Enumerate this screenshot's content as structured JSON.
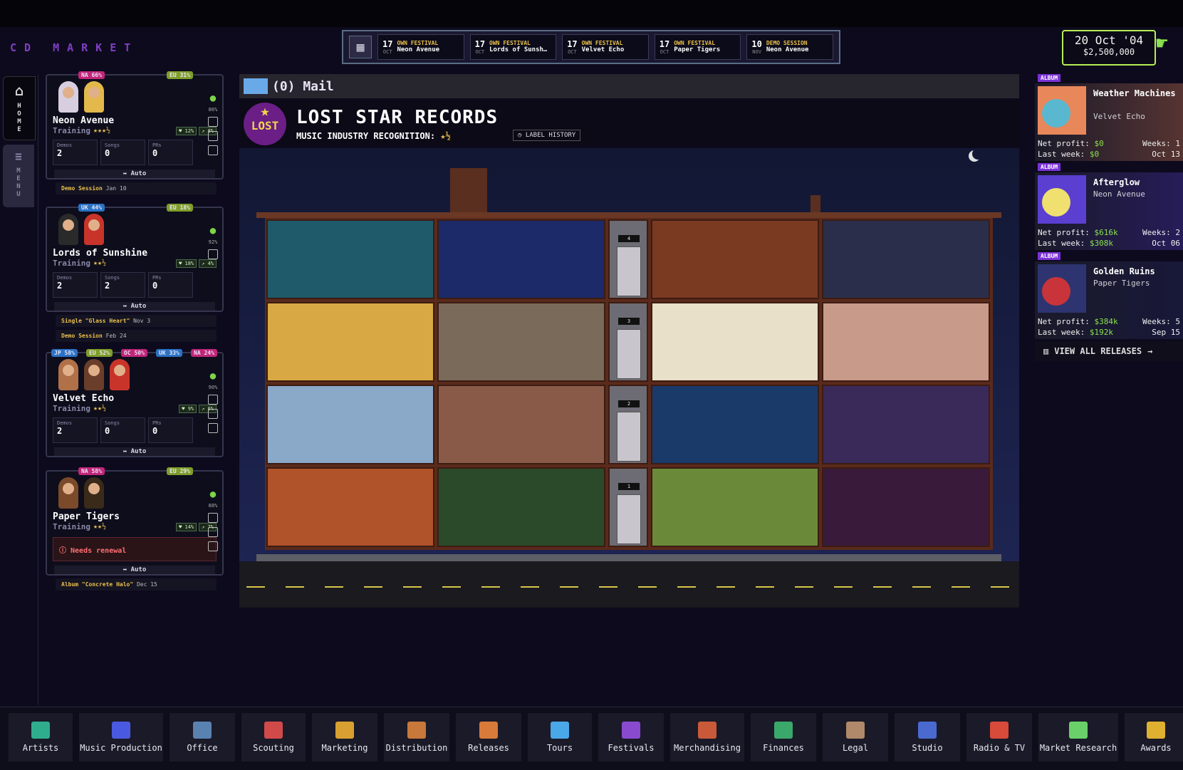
{
  "app": {
    "brand": "CD MARKET"
  },
  "calendar": {
    "events": [
      {
        "day": "17",
        "month": "OCT",
        "type": "OWN FESTIVAL",
        "name": "Neon Avenue"
      },
      {
        "day": "17",
        "month": "OCT",
        "type": "OWN FESTIVAL",
        "name": "Lords of Sunsh…"
      },
      {
        "day": "17",
        "month": "OCT",
        "type": "OWN FESTIVAL",
        "name": "Velvet Echo"
      },
      {
        "day": "17",
        "month": "OCT",
        "type": "OWN FESTIVAL",
        "name": "Paper Tigers"
      },
      {
        "day": "10",
        "month": "NOV",
        "type": "DEMO SESSION",
        "name": "Neon Avenue"
      }
    ]
  },
  "status": {
    "date": "20 Oct '04",
    "money": "$2,500,000"
  },
  "leftnav": {
    "home": "HOME",
    "menu": "MENU"
  },
  "artists": [
    {
      "name": "Neon Avenue",
      "training": "Training",
      "stars": "★★★½",
      "tags": [
        {
          "t": "NA 66%",
          "c": "#c2267a"
        },
        {
          "t": "EU 31%",
          "c": "#7f9e2a"
        }
      ],
      "pct": "86%",
      "stat1": "12%",
      "stat2": "8%",
      "demos_l": "Demos",
      "demos": "2",
      "songs_l": "Songs",
      "songs": "0",
      "prs_l": "PRs",
      "prs": "0",
      "auto": "↔ Auto",
      "tasks": [
        {
          "name": "Demo Session",
          "date": "Jan 10"
        }
      ]
    },
    {
      "name": "Lords of Sunshine",
      "training": "Training",
      "stars": "★★½",
      "tags": [
        {
          "t": "UK 44%",
          "c": "#2a72c4"
        },
        {
          "t": "EU 18%",
          "c": "#7f9e2a"
        }
      ],
      "pct": "92%",
      "stat1": "18%",
      "stat2": "4%",
      "demos_l": "Demos",
      "demos": "2",
      "songs_l": "Songs",
      "songs": "2",
      "prs_l": "PRs",
      "prs": "0",
      "auto": "↔ Auto",
      "tasks": [
        {
          "name": "Single \"Glass Heart\"",
          "date": "Nov 3"
        },
        {
          "name": "Demo Session",
          "date": "Feb 24"
        }
      ]
    },
    {
      "name": "Velvet Echo",
      "training": "Training",
      "stars": "★★½",
      "tags": [
        {
          "t": "JP 58%",
          "c": "#2a72c4"
        },
        {
          "t": "EU 52%",
          "c": "#7f9e2a"
        },
        {
          "t": "OC 50%",
          "c": "#c2267a"
        },
        {
          "t": "UK 33%",
          "c": "#2a72c4"
        },
        {
          "t": "NA 24%",
          "c": "#c2267a"
        }
      ],
      "pct": "90%",
      "stat1": "9%",
      "stat2": "6%",
      "demos_l": "Demos",
      "demos": "2",
      "songs_l": "Songs",
      "songs": "0",
      "prs_l": "PRs",
      "prs": "0",
      "auto": "↔ Auto",
      "tasks": []
    },
    {
      "name": "Paper Tigers",
      "training": "Training",
      "stars": "★★½",
      "tags": [
        {
          "t": "NA 58%",
          "c": "#c2267a"
        },
        {
          "t": "EU 29%",
          "c": "#7f9e2a"
        }
      ],
      "pct": "88%",
      "stat1": "14%",
      "stat2": "7%",
      "renew": "Needs renewal",
      "auto": "↔ Auto",
      "tasks": [
        {
          "name": "Album \"Concrete Halo\"",
          "date": "Dec 15"
        }
      ]
    }
  ],
  "mail": {
    "label": "(0) Mail"
  },
  "label": {
    "logo": "LOST",
    "name": "LOST STAR RECORDS",
    "recognition": "MUSIC INDUSTRY RECOGNITION:",
    "recognition_stars": "★½",
    "history": "LABEL HISTORY"
  },
  "building": {
    "floors": [
      "4",
      "3",
      "2",
      "1"
    ]
  },
  "releases": {
    "items": [
      {
        "tag": "ALBUM",
        "title": "Weather Machines",
        "artist": "Velvet Echo",
        "net_l": "Net profit:",
        "net": "$0",
        "weeks": "Weeks: 1",
        "last_l": "Last week:",
        "last": "$0",
        "date": "Oct 13",
        "colors": [
          "#e8875a",
          "#5ab7d0"
        ]
      },
      {
        "tag": "ALBUM",
        "title": "Afterglow",
        "artist": "Neon Avenue",
        "net_l": "Net profit:",
        "net": "$616k",
        "weeks": "Weeks: 2",
        "last_l": "Last week:",
        "last": "$308k",
        "date": "Oct 06",
        "colors": [
          "#5a3fd0",
          "#f0e070"
        ]
      },
      {
        "tag": "ALBUM",
        "title": "Golden Ruins",
        "artist": "Paper Tigers",
        "net_l": "Net profit:",
        "net": "$384k",
        "weeks": "Weeks: 5",
        "last_l": "Last week:",
        "last": "$192k",
        "date": "Sep 15",
        "colors": [
          "#2d3470",
          "#c8343a"
        ]
      }
    ],
    "view_all": "VIEW ALL RELEASES"
  },
  "bottom_nav": [
    {
      "label": "Artists",
      "color": "#2fae8e"
    },
    {
      "label": "Music Production",
      "color": "#4a5ae0"
    },
    {
      "label": "Office",
      "color": "#5a82b0"
    },
    {
      "label": "Scouting",
      "color": "#d04a4a"
    },
    {
      "label": "Marketing",
      "color": "#d8a030"
    },
    {
      "label": "Distribution",
      "color": "#c8783a"
    },
    {
      "label": "Releases",
      "color": "#d87a3a"
    },
    {
      "label": "Tours",
      "color": "#4aa8e8"
    },
    {
      "label": "Festivals",
      "color": "#8a4ad0"
    },
    {
      "label": "Merchandising",
      "color": "#c85a3a"
    },
    {
      "label": "Finances",
      "color": "#3aa86a"
    },
    {
      "label": "Legal",
      "color": "#b0886a"
    },
    {
      "label": "Studio",
      "color": "#4a6ad0"
    },
    {
      "label": "Radio & TV",
      "color": "#d84a3a"
    },
    {
      "label": "Market Research",
      "color": "#6ad06a"
    },
    {
      "label": "Awards",
      "color": "#e0b030"
    }
  ]
}
